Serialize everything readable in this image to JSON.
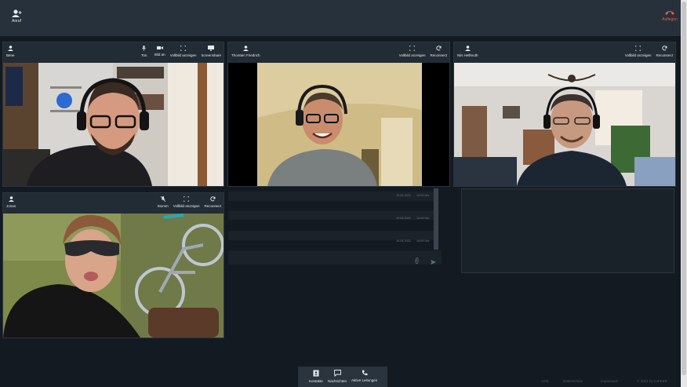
{
  "topbar": {
    "call_label": "Anruf",
    "hangup_label": "Auflegen"
  },
  "controls": {
    "mute": "Ton",
    "camera": "Bild an",
    "fullscreen": "Vollbild anzeigen",
    "screenshare": "Screenshare",
    "reconnect": "Reconnect",
    "stumm": "Stumm"
  },
  "participants": [
    {
      "name": "Bene"
    },
    {
      "name": "Thorsten Friedrich"
    },
    {
      "name": "Nils Hellmuth"
    },
    {
      "name": "Jonas"
    }
  ],
  "chat": {
    "dates": [
      "19.04.2021",
      "19.04.2021",
      "19.04.2021"
    ],
    "times": [
      "14:09 Uhr",
      "14:09 Uhr",
      "14:09 Uhr"
    ]
  },
  "bottombar": {
    "contacts": "Kontakte",
    "messages": "Nachrichten",
    "active_calls": "Aktive Leitungen"
  },
  "footer": {
    "agb": "AGB",
    "privacy": "Datenschutz",
    "imprint": "Impressum",
    "copyright": "© 2021 by noFEER"
  },
  "colors": {
    "hangup": "#e25b4a",
    "background": "#131a21",
    "panel": "#1d252d"
  }
}
